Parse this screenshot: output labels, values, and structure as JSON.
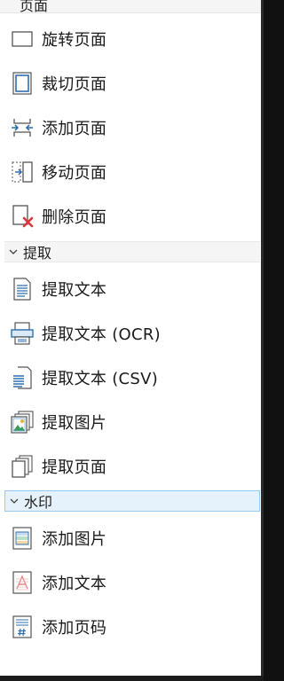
{
  "sections": {
    "page": {
      "title": "页面"
    },
    "extract": {
      "title": "提取"
    },
    "watermark": {
      "title": "水印"
    }
  },
  "page_items": [
    {
      "label": "旋转页面",
      "icon": "rotate-page-icon"
    },
    {
      "label": "裁切页面",
      "icon": "crop-page-icon"
    },
    {
      "label": "添加页面",
      "icon": "add-page-icon"
    },
    {
      "label": "移动页面",
      "icon": "move-page-icon"
    },
    {
      "label": "删除页面",
      "icon": "delete-page-icon"
    }
  ],
  "extract_items": [
    {
      "label": "提取文本",
      "icon": "extract-text-icon"
    },
    {
      "label": "提取文本 (OCR)",
      "icon": "extract-text-ocr-icon"
    },
    {
      "label": "提取文本 (CSV)",
      "icon": "extract-text-csv-icon"
    },
    {
      "label": "提取图片",
      "icon": "extract-images-icon"
    },
    {
      "label": "提取页面",
      "icon": "extract-pages-icon"
    }
  ],
  "watermark_items": [
    {
      "label": "添加图片",
      "icon": "add-image-watermark-icon"
    },
    {
      "label": "添加文本",
      "icon": "add-text-watermark-icon"
    },
    {
      "label": "添加页码",
      "icon": "add-page-number-icon"
    }
  ],
  "colors": {
    "selected_bg": "#e5f1fb",
    "selected_border": "#99c9ef",
    "icon_blue": "#2f6fb0",
    "delete_red": "#d9363e"
  }
}
